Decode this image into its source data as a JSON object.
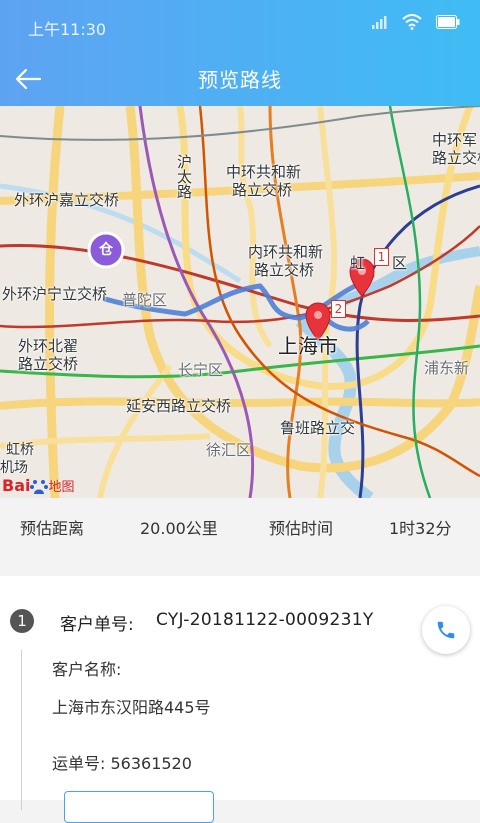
{
  "status_bar": {
    "time": "上午11:30"
  },
  "header": {
    "title": "预览路线",
    "back_icon": "back-arrow-icon"
  },
  "map": {
    "labels": {
      "waihuan_jiading": "外环沪嘉立交桥",
      "waihuan_ning": "外环沪宁立交桥",
      "waihuan_beizhai_1": "外环北翟",
      "waihuan_beizhai_2": "路立交桥",
      "putuo": "普陀区",
      "hutai": "沪太路",
      "zhonghuan_gonghe_1": "中环共和新",
      "zhonghuan_gonghe_2": "路立交桥",
      "neihuan_gonghe_1": "内环共和新",
      "neihuan_gonghe_2": "路立交桥",
      "zhonghuan_jun_1": "中环军",
      "zhonghuan_jun_2": "路立交桥",
      "hongkou_1": "虹",
      "hongkou_2": "区",
      "shanghai": "上海市",
      "pudong": "浦东新",
      "changning": "长宁区",
      "yanan": "延安西路立交桥",
      "luban": "鲁班路立交",
      "xuhui": "徐汇区",
      "hongqiao_1": "虹桥",
      "hongqiao_2": "机场"
    },
    "pins": [
      {
        "label": "1"
      },
      {
        "label": "2"
      }
    ],
    "start_marker_glyph": "仓",
    "logo_text": "Bai",
    "logo_suffix": "地图"
  },
  "stats": {
    "distance_label": "预估距离",
    "distance_value": "20.00公里",
    "time_label": "预估时间",
    "time_value": "1时32分"
  },
  "order": {
    "index": "1",
    "order_label": "客户单号:",
    "order_value": "CYJ-20181122-0009231Y",
    "customer_label": "客户名称:",
    "address": "上海市东汉阳路445号",
    "waybill": "运单号: 56361520"
  },
  "colors": {
    "header_gradient_start": "#5ea3f2",
    "header_gradient_end": "#3fbcf4",
    "route": "#4e7fd6",
    "pin": "#e8333a",
    "accent": "#2f8fe8"
  }
}
